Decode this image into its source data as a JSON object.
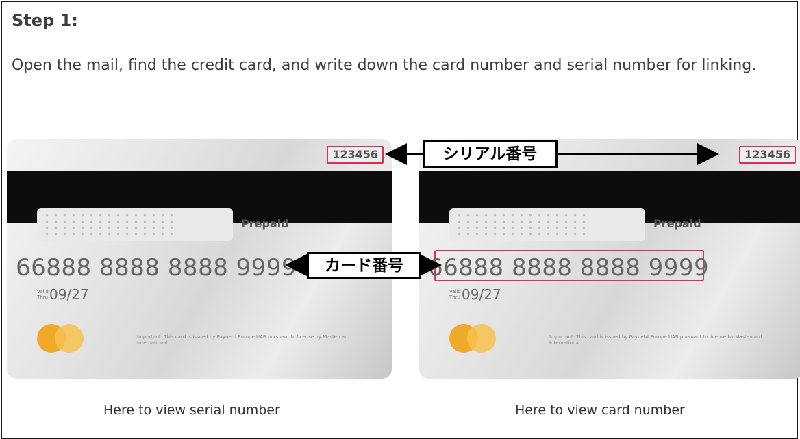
{
  "step": {
    "title": "Step 1:",
    "instruction": "Open the mail, find the credit card, and write down the card number and serial number for linking."
  },
  "cards": {
    "left": {
      "serial": "123456",
      "prepaid": "Prepaid",
      "number": "66888 8888 8888 9999",
      "valid_label": "Valid Thru",
      "expiry": "09/27",
      "fineprint": "Important: This card is issued by Paynetd Europe UAB pursuant to license by Mastercard International."
    },
    "right": {
      "serial": "123456",
      "prepaid": "Prepaid",
      "number": "66888 8888 8888 9999",
      "valid_label": "Valid Thru",
      "expiry": "09/27",
      "fineprint": "Important: This card is issued by Paynetd Europe UAB pursuant to license by Mastercard International."
    }
  },
  "annotations": {
    "serial_tag": "シリアル番号",
    "card_tag": "カード番号"
  },
  "captions": {
    "left": "Here to view serial number",
    "right": "Here to view card number"
  },
  "colors": {
    "highlight": "#d6315a",
    "arrow": "#000000"
  },
  "icons": {
    "brand_logo": "card-brand-logo-icon"
  }
}
